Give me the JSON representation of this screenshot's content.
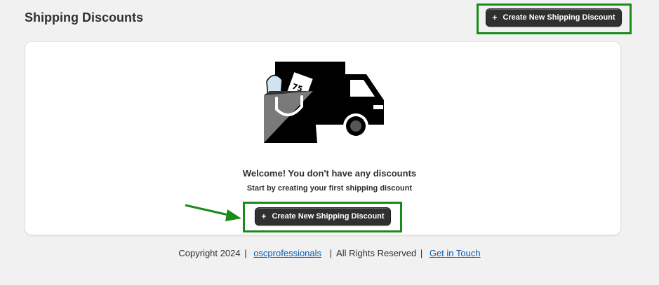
{
  "page": {
    "title": "Shipping Discounts"
  },
  "header_action": {
    "create_label": "Create New Shipping Discount",
    "icon": "plus-icon"
  },
  "empty_state": {
    "illustration": "truck-shopping-bag-icon",
    "heading": "Welcome! You don't have any discounts",
    "subheading": "Start by creating your first shipping discount",
    "create_label": "Create New Shipping Discount",
    "tag_text": "75"
  },
  "footer": {
    "copyright": "Copyright 2024",
    "company_link": "oscprofessionals",
    "rights": "All Rights Reserved",
    "contact_link": "Get in Touch"
  },
  "colors": {
    "background": "#f1f1f1",
    "button": "#303030",
    "highlight": "#1a8a1a",
    "link": "#0b5cad"
  }
}
